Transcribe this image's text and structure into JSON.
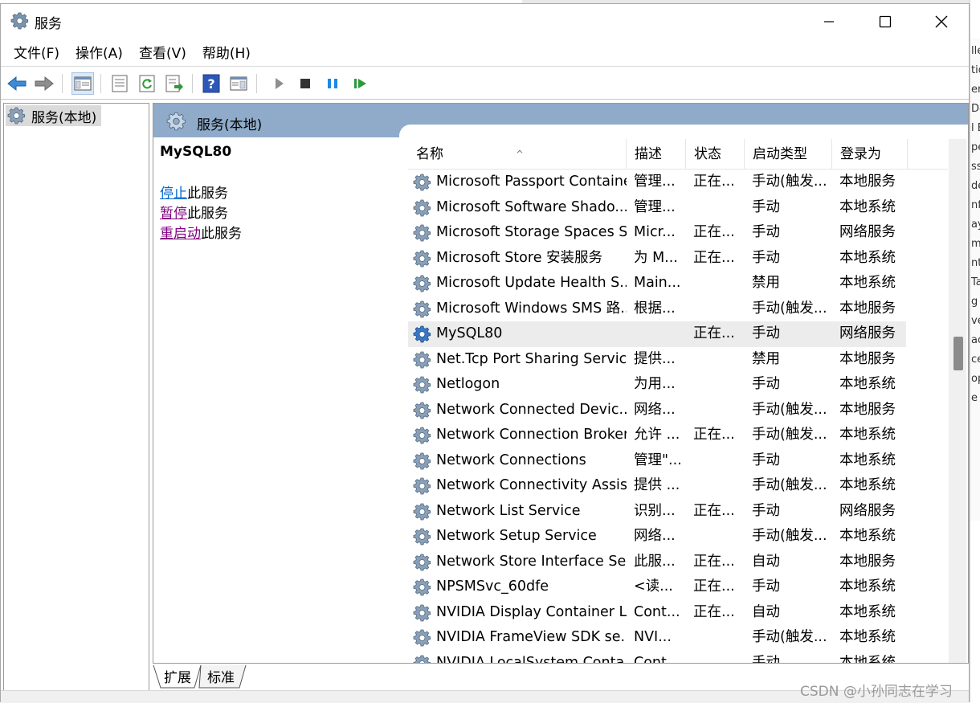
{
  "window": {
    "title": "服务"
  },
  "menu": [
    "文件(F)",
    "操作(A)",
    "查看(V)",
    "帮助(H)"
  ],
  "tree": {
    "root": "服务(本地)"
  },
  "panel": {
    "header": "服务(本地)"
  },
  "detail": {
    "service_name": "MySQL80",
    "stop_link": "停止",
    "stop_suffix": "此服务",
    "pause_link": "暂停",
    "pause_suffix": "此服务",
    "restart_link": "重启动",
    "restart_suffix": "此服务"
  },
  "columns": {
    "name": "名称",
    "desc": "描述",
    "status": "状态",
    "startup": "启动类型",
    "logon": "登录为"
  },
  "rows": [
    {
      "name": "Microsoft Passport Container",
      "desc": "管理...",
      "status": "正在...",
      "startup": "手动(触发...",
      "logon": "本地服务"
    },
    {
      "name": "Microsoft Software Shado...",
      "desc": "管理...",
      "status": "",
      "startup": "手动",
      "logon": "本地系统"
    },
    {
      "name": "Microsoft Storage Spaces S...",
      "desc": "Micr...",
      "status": "正在...",
      "startup": "手动",
      "logon": "网络服务"
    },
    {
      "name": "Microsoft Store 安装服务",
      "desc": "为 M...",
      "status": "正在...",
      "startup": "手动",
      "logon": "本地系统"
    },
    {
      "name": "Microsoft Update Health S...",
      "desc": "Main...",
      "status": "",
      "startup": "禁用",
      "logon": "本地系统"
    },
    {
      "name": "Microsoft Windows SMS 路...",
      "desc": "根据...",
      "status": "",
      "startup": "手动(触发...",
      "logon": "本地服务"
    },
    {
      "name": "MySQL80",
      "desc": "",
      "status": "正在...",
      "startup": "手动",
      "logon": "网络服务"
    },
    {
      "name": "Net.Tcp Port Sharing Service",
      "desc": "提供...",
      "status": "",
      "startup": "禁用",
      "logon": "本地服务"
    },
    {
      "name": "Netlogon",
      "desc": "为用...",
      "status": "",
      "startup": "手动",
      "logon": "本地系统"
    },
    {
      "name": "Network Connected Devic...",
      "desc": "网络...",
      "status": "",
      "startup": "手动(触发...",
      "logon": "本地服务"
    },
    {
      "name": "Network Connection Broker",
      "desc": "允许 ...",
      "status": "正在...",
      "startup": "手动(触发...",
      "logon": "本地系统"
    },
    {
      "name": "Network Connections",
      "desc": "管理\"...",
      "status": "",
      "startup": "手动",
      "logon": "本地系统"
    },
    {
      "name": "Network Connectivity Assis...",
      "desc": "提供 ...",
      "status": "",
      "startup": "手动(触发...",
      "logon": "本地系统"
    },
    {
      "name": "Network List Service",
      "desc": "识别...",
      "status": "正在...",
      "startup": "手动",
      "logon": "网络服务"
    },
    {
      "name": "Network Setup Service",
      "desc": "网络...",
      "status": "",
      "startup": "手动(触发...",
      "logon": "本地系统"
    },
    {
      "name": "Network Store Interface Se...",
      "desc": "此服...",
      "status": "正在...",
      "startup": "自动",
      "logon": "本地服务"
    },
    {
      "name": "NPSMSvc_60dfe",
      "desc": "<读...",
      "status": "正在...",
      "startup": "手动",
      "logon": "本地系统"
    },
    {
      "name": "NVIDIA Display Container LS",
      "desc": "Cont...",
      "status": "正在...",
      "startup": "自动",
      "logon": "本地系统"
    },
    {
      "name": "NVIDIA FrameView SDK se...",
      "desc": "NVI...",
      "status": "",
      "startup": "手动(触发...",
      "logon": "本地系统"
    },
    {
      "name": "NVIDIA LocalSystem Conta...",
      "desc": "Cont...",
      "status": "",
      "startup": "手动",
      "logon": "本地系统"
    }
  ],
  "selected_row": "MySQL80",
  "tabs": [
    "扩展",
    "标准"
  ],
  "watermark": "CSDN @小孙同志在学习",
  "background_fragments": [
    "lle",
    "tio",
    "er",
    "Del",
    "l E",
    "pe",
    "ss",
    "de",
    "nfo",
    "ay",
    "m",
    "nt",
    "Ta",
    "g E",
    "ve",
    "ac",
    "ce",
    "op",
    "e S"
  ],
  "colors": {
    "header_band": "#8fabc9",
    "link_blue": "#0066cc",
    "link_purple": "#800080",
    "selection": "#ececec"
  }
}
